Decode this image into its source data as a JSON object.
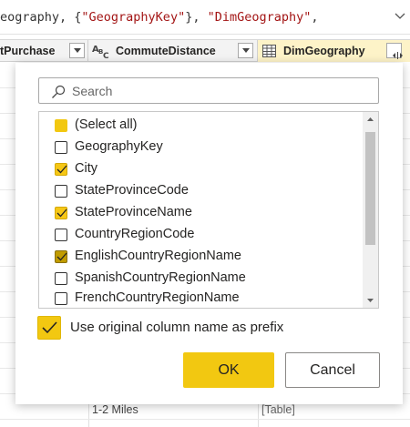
{
  "formula": {
    "prefix": "eography, {",
    "key_literal": "\"GeographyKey\"",
    "middle": "}, ",
    "table_literal": "\"DimGeography\"",
    "suffix": ","
  },
  "columns": {
    "col1_label": "tPurchase",
    "col2_type_icon": "text-type-icon",
    "col2_label": "CommuteDistance",
    "col3_type_icon": "table-type-icon",
    "col3_label": "DimGeography"
  },
  "grid": {
    "bottom_row": {
      "commute": "1-2 Miles",
      "geo": "[Table]"
    }
  },
  "dialog": {
    "search": {
      "placeholder": "Search",
      "value": ""
    },
    "items": [
      {
        "label": "(Select all)",
        "state": "partial"
      },
      {
        "label": "GeographyKey",
        "state": "unchecked"
      },
      {
        "label": "City",
        "state": "checked"
      },
      {
        "label": "StateProvinceCode",
        "state": "unchecked"
      },
      {
        "label": "StateProvinceName",
        "state": "checked"
      },
      {
        "label": "CountryRegionCode",
        "state": "unchecked"
      },
      {
        "label": "EnglishCountryRegionName",
        "state": "checked-focused"
      },
      {
        "label": "SpanishCountryRegionName",
        "state": "unchecked"
      },
      {
        "label": "FrenchCountryRegionName",
        "state": "unchecked"
      }
    ],
    "prefix_option": {
      "label": "Use original column name as prefix",
      "checked": true
    },
    "ok_label": "OK",
    "cancel_label": "Cancel"
  },
  "colors": {
    "accent": "#f2c811",
    "check_dark": "#c19c00",
    "header_bg": "#f3f3f3",
    "dim_header_bg": "#fdf3c8"
  }
}
